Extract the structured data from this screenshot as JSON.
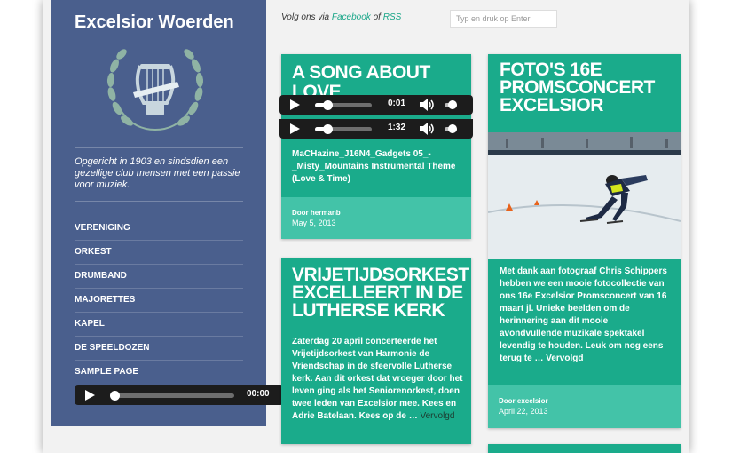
{
  "site": {
    "title": "Excelsior Woerden",
    "tagline": "Opgericht in 1903 en sindsdien een gezellige club mensen met een passie voor muziek."
  },
  "nav": [
    "VERENIGING",
    "ORKEST",
    "DRUMBAND",
    "MAJORETTES",
    "KAPEL",
    "DE SPEELDOZEN",
    "SAMPLE PAGE"
  ],
  "sidebar_player": {
    "time": "00:00",
    "progress": 0.0
  },
  "topbar": {
    "follow_prefix": "Volg ons via",
    "facebook": "Facebook",
    "of": "of",
    "rss": "RSS",
    "search_placeholder": "Typ en druk op Enter"
  },
  "posts": [
    {
      "title": "A SONG ABOUT LOVE",
      "players": [
        {
          "time": "0:01",
          "progress": 0.22
        },
        {
          "time": "1:32",
          "progress": 0.22
        }
      ],
      "body": "MaCHazine_J16N4_Gadgets 05_-_Misty_Mountains Instrumental Theme (Love & Time)",
      "author": "Door hermanb",
      "date": "May 5, 2013"
    },
    {
      "title": "FOTO'S 16E PROMSCONCERT EXCELSIOR",
      "body": "Met dank aan fotograaf Chris Schippers hebben we een mooie fotocollectie van ons 16e Excelsior Promsconcert van 16 maart jl. Unieke beelden om de herinnering aan dit mooie avondvullende muzikale spektakel levendig te houden. Leuk om nog eens terug te …",
      "more": "Vervolgd",
      "author": "Door excelsior",
      "date": "April 22, 2013"
    },
    {
      "title": "VRIJETIJDSORKEST EXCELLEERT IN DE LUTHERSE KERK",
      "body": "Zaterdag 20 april concerteerde het Vrijetijdsorkest van Harmonie de Vriendschap in de sfeervolle Lutherse kerk. Aan dit orkest dat vroeger door het leven ging als het Seniorenorkest, doen twee leden van Excelsior mee. Kees en Adrie Batelaan. Kees op de …",
      "more": "Vervolgd"
    }
  ],
  "colors": {
    "sidebar": "#4a5f8d",
    "card": "#1aab8b",
    "card_footer": "#43c3a8",
    "link": "#19a688"
  }
}
